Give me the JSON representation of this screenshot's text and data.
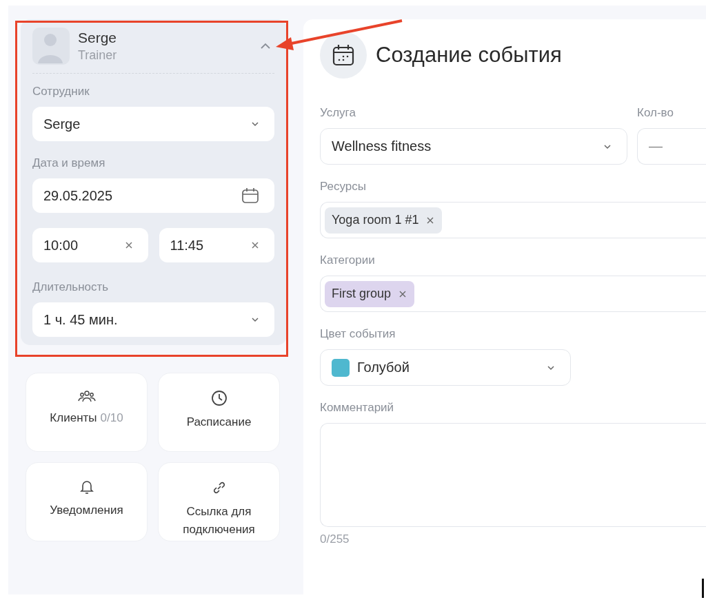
{
  "staff_card": {
    "name": "Serge",
    "role": "Trainer",
    "expanded": true,
    "employee": {
      "label": "Сотрудник",
      "value": "Serge"
    },
    "datetime": {
      "label": "Дата и время",
      "date": "29.05.2025",
      "start": "10:00",
      "end": "11:45"
    },
    "duration": {
      "label": "Длительность",
      "value": "1 ч. 45 мин."
    }
  },
  "tiles": [
    {
      "label": "Клиенты",
      "count": "0/10",
      "kind": "clients"
    },
    {
      "label": "Расписание",
      "kind": "schedule"
    },
    {
      "label": "Уведомления",
      "kind": "notifications"
    },
    {
      "label": "Ссылка для подключения",
      "kind": "link"
    }
  ],
  "form": {
    "title": "Создание события",
    "service": {
      "label": "Услуга",
      "value": "Wellness fitness"
    },
    "quantity": {
      "label": "Кол-во",
      "placeholder": "—"
    },
    "resources": {
      "label": "Ресурсы",
      "tags": [
        {
          "text": "Yoga room 1 #1",
          "color": "#e8ebf0"
        }
      ]
    },
    "categories": {
      "label": "Категории",
      "tags": [
        {
          "text": "First group",
          "color": "#ddd5ee"
        }
      ]
    },
    "event_color": {
      "label": "Цвет события",
      "value": "Голубой",
      "color": "#4fb8cf"
    },
    "comment": {
      "label": "Комментарий",
      "counter": "0/255"
    }
  }
}
